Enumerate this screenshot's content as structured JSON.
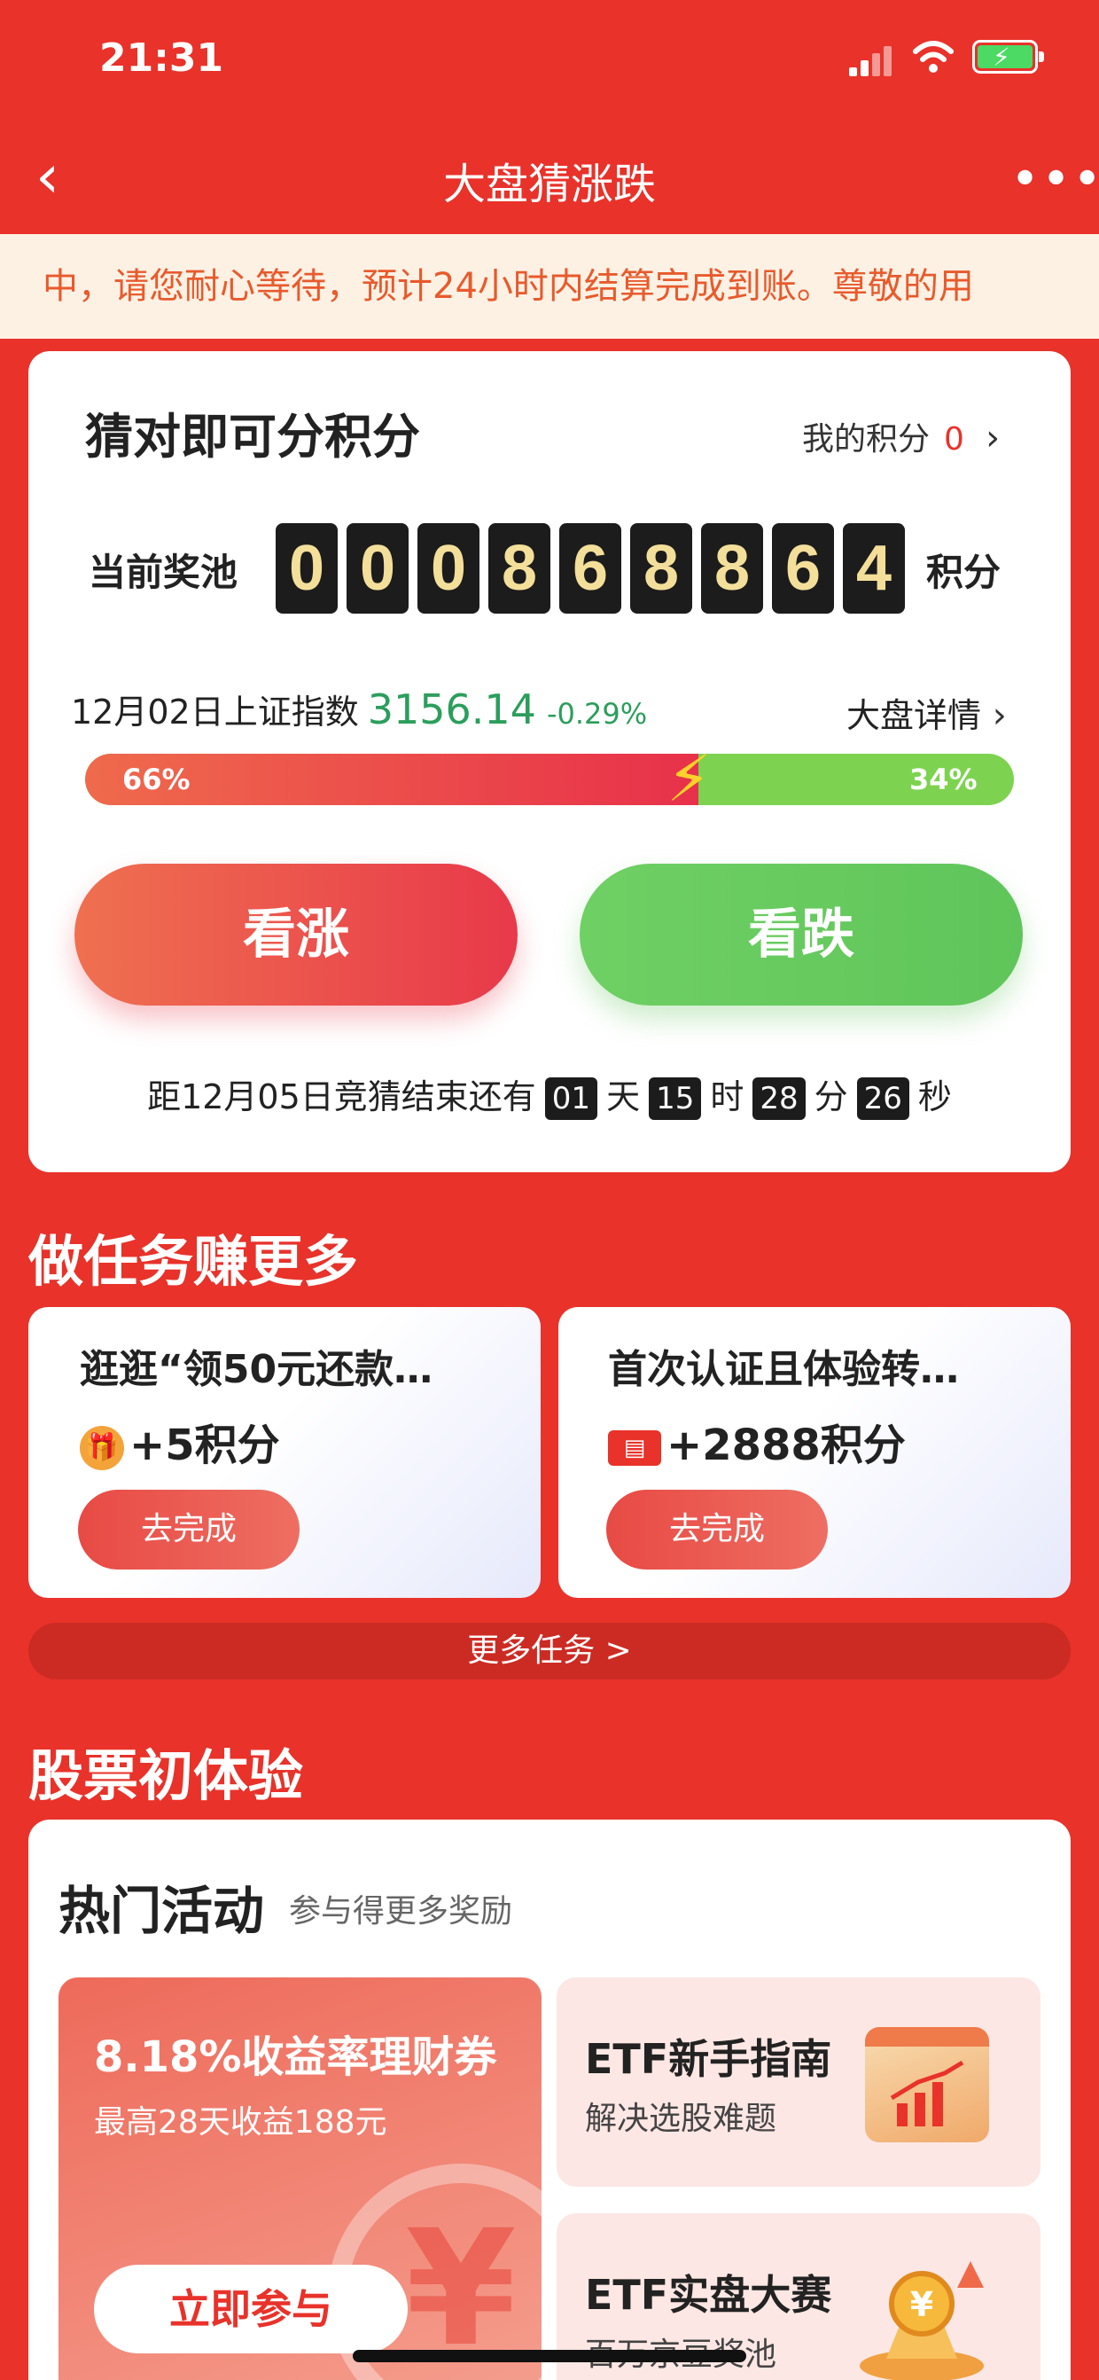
{
  "status_bar": {
    "time": "21:31"
  },
  "nav": {
    "title": "大盘猜涨跌"
  },
  "marquee": {
    "text": "中，请您耐心等待，预计24小时内结算完成到账。尊敬的用"
  },
  "guess": {
    "title": "猜对即可分积分",
    "my_points_label": "我的积分",
    "my_points_value": "0",
    "pool_label": "当前奖池",
    "pool_digits": [
      "0",
      "0",
      "0",
      "8",
      "6",
      "8",
      "8",
      "6",
      "4"
    ],
    "pool_unit": "积分",
    "index_label": "12月02日上证指数",
    "index_value": "3156.14",
    "index_change": "-0.29%",
    "detail_label": "大盘详情",
    "up_pct": "66%",
    "down_pct": "34%",
    "up_ratio": 0.66,
    "up_button": "看涨",
    "down_button": "看跌",
    "countdown_prefix": "距12月05日竞猜结束还有",
    "days": "01",
    "days_unit": "天",
    "hours": "15",
    "hours_unit": "时",
    "minutes": "28",
    "minutes_unit": "分",
    "seconds": "26",
    "seconds_unit": "秒"
  },
  "tasks": {
    "section_title": "做任务赚更多",
    "items": [
      {
        "title": "逛逛“领50元还款…",
        "reward": "+5积分",
        "button": "去完成",
        "icon": "gift-coin-icon"
      },
      {
        "title": "首次认证且体验转…",
        "reward": "+2888积分",
        "button": "去完成",
        "icon": "ticket-icon"
      }
    ],
    "more_label": "更多任务 >"
  },
  "experience": {
    "section_title": "股票初体验",
    "hot_title": "热门活动",
    "hot_subtitle": "参与得更多奖励",
    "act1": {
      "title": "8.18%收益率理财券",
      "subtitle": "最高28天收益188元",
      "button": "立即参与"
    },
    "act2": {
      "title": "ETF新手指南",
      "subtitle": "解决选股难题"
    },
    "act3": {
      "title": "ETF实盘大赛",
      "subtitle": "百万京豆奖池"
    }
  },
  "colors": {
    "brand_red": "#e8322a",
    "up_green": "#2b9e5b",
    "digit_gold": "#f3df9a"
  }
}
